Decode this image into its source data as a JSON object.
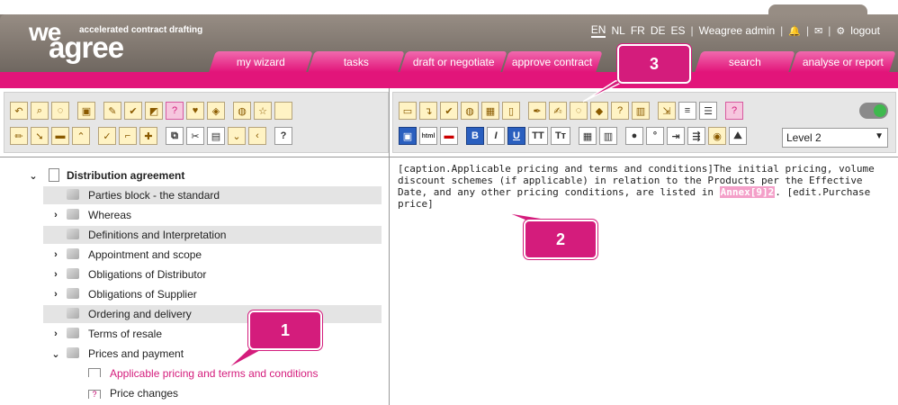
{
  "brand": {
    "logo_we": "we",
    "logo_agree": "agree",
    "tagline": "accelerated contract drafting"
  },
  "topnav": {
    "languages": [
      "EN",
      "NL",
      "FR",
      "DE",
      "ES"
    ],
    "active_language": "EN",
    "user": "Weagree admin",
    "logout": "logout"
  },
  "tabs": [
    "my wizard",
    "tasks",
    "draft or negotiate",
    "approve contract",
    "search",
    "analyse or report"
  ],
  "editor_toolbar": {
    "level_select": "Level 2"
  },
  "tree": {
    "root": "Distribution agreement",
    "items": [
      "Parties block - the standard",
      "Whereas",
      "Definitions and Interpretation",
      "Appointment and scope",
      "Obligations of Distributor",
      "Obligations of Supplier",
      "Ordering and delivery",
      "Terms of resale",
      "Prices and payment"
    ],
    "children": [
      "Applicable pricing and terms and conditions",
      "Price changes"
    ]
  },
  "editor": {
    "text_before": "[caption.Applicable pricing and terms and conditions]The initial pricing, volume discount schemes (if applicable) in relation to the Products per the Effective Date, and any other pricing conditions, are listed in ",
    "annex": "Annex[9]2",
    "text_after": ". [edit.Purchase price]"
  },
  "callouts": [
    "1",
    "2",
    "3"
  ],
  "colors": {
    "accent": "#e2157a",
    "header": "#7f766e",
    "callout": "#d41c7c"
  }
}
